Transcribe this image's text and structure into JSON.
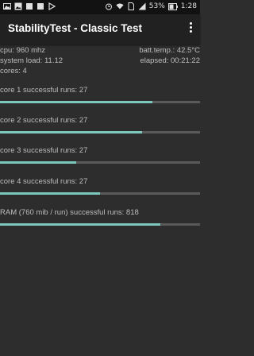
{
  "status_bar": {
    "battery": "53%",
    "time": "1:28"
  },
  "app_bar": {
    "title": "StabilityTest - Classic Test"
  },
  "info": {
    "cpu": "cpu: 960 mhz",
    "batt_temp": "batt.temp.: 42.5°C",
    "system_load": "system load: 11.12",
    "elapsed": "elapsed: 00:21:22",
    "cores": "cores: 4"
  },
  "tests": [
    {
      "label": "core 1 successful runs: 27",
      "progress": 0.76
    },
    {
      "label": "core 2 successful runs: 27",
      "progress": 0.71
    },
    {
      "label": "core 3 successful runs: 27",
      "progress": 0.38
    },
    {
      "label": "core 4 successful runs: 27",
      "progress": 0.5
    },
    {
      "label": "RAM (760 mib / run) successful runs: 818",
      "progress": 0.8
    }
  ],
  "colors": {
    "background": "#2d2d2d",
    "accent": "#7cc8bd",
    "track": "#5a5a5a"
  },
  "icons": [
    "photo-icon",
    "image-icon",
    "square-icon",
    "square-icon",
    "play-store-icon",
    "alarm-icon",
    "wifi-icon",
    "sim-icon",
    "signal-icon",
    "battery-icon"
  ]
}
